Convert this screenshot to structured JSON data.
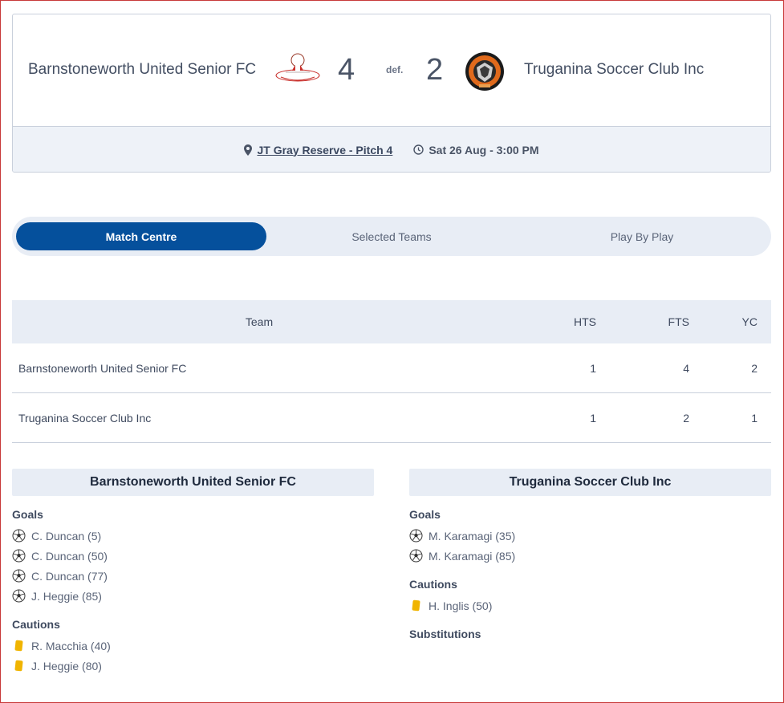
{
  "match": {
    "home_team": "Barnstoneworth United Senior FC",
    "away_team": "Truganina Soccer Club Inc",
    "home_score": "4",
    "away_score": "2",
    "result_word": "def.",
    "venue": "JT Gray Reserve - Pitch 4",
    "datetime": "Sat 26 Aug - 3:00 PM"
  },
  "tabs": [
    {
      "label": "Match Centre",
      "active": true
    },
    {
      "label": "Selected Teams",
      "active": false
    },
    {
      "label": "Play By Play",
      "active": false
    }
  ],
  "table": {
    "headers": {
      "team": "Team",
      "hts": "HTS",
      "fts": "FTS",
      "yc": "YC"
    },
    "rows": [
      {
        "team": "Barnstoneworth United Senior FC",
        "hts": "1",
        "fts": "4",
        "yc": "2"
      },
      {
        "team": "Truganina Soccer Club Inc",
        "hts": "1",
        "fts": "2",
        "yc": "1"
      }
    ]
  },
  "home_panel": {
    "title": "Barnstoneworth United Senior FC",
    "goals_title": "Goals",
    "goals": [
      "C. Duncan (5)",
      "C. Duncan (50)",
      "C. Duncan (77)",
      "J. Heggie (85)"
    ],
    "cautions_title": "Cautions",
    "cautions": [
      "R. Macchia (40)",
      "J. Heggie (80)"
    ]
  },
  "away_panel": {
    "title": "Truganina Soccer Club Inc",
    "goals_title": "Goals",
    "goals": [
      "M. Karamagi (35)",
      "M. Karamagi (85)"
    ],
    "cautions_title": "Cautions",
    "cautions": [
      "H. Inglis (50)"
    ],
    "subs_title": "Substitutions"
  },
  "colors": {
    "accent": "#05509c",
    "panel_bg": "#e8edf5",
    "yellow_card": "#f0b400"
  },
  "icons": {
    "venue": "map-pin-icon",
    "time": "clock-icon",
    "goal": "soccer-ball-icon",
    "caution": "yellow-card-icon"
  }
}
